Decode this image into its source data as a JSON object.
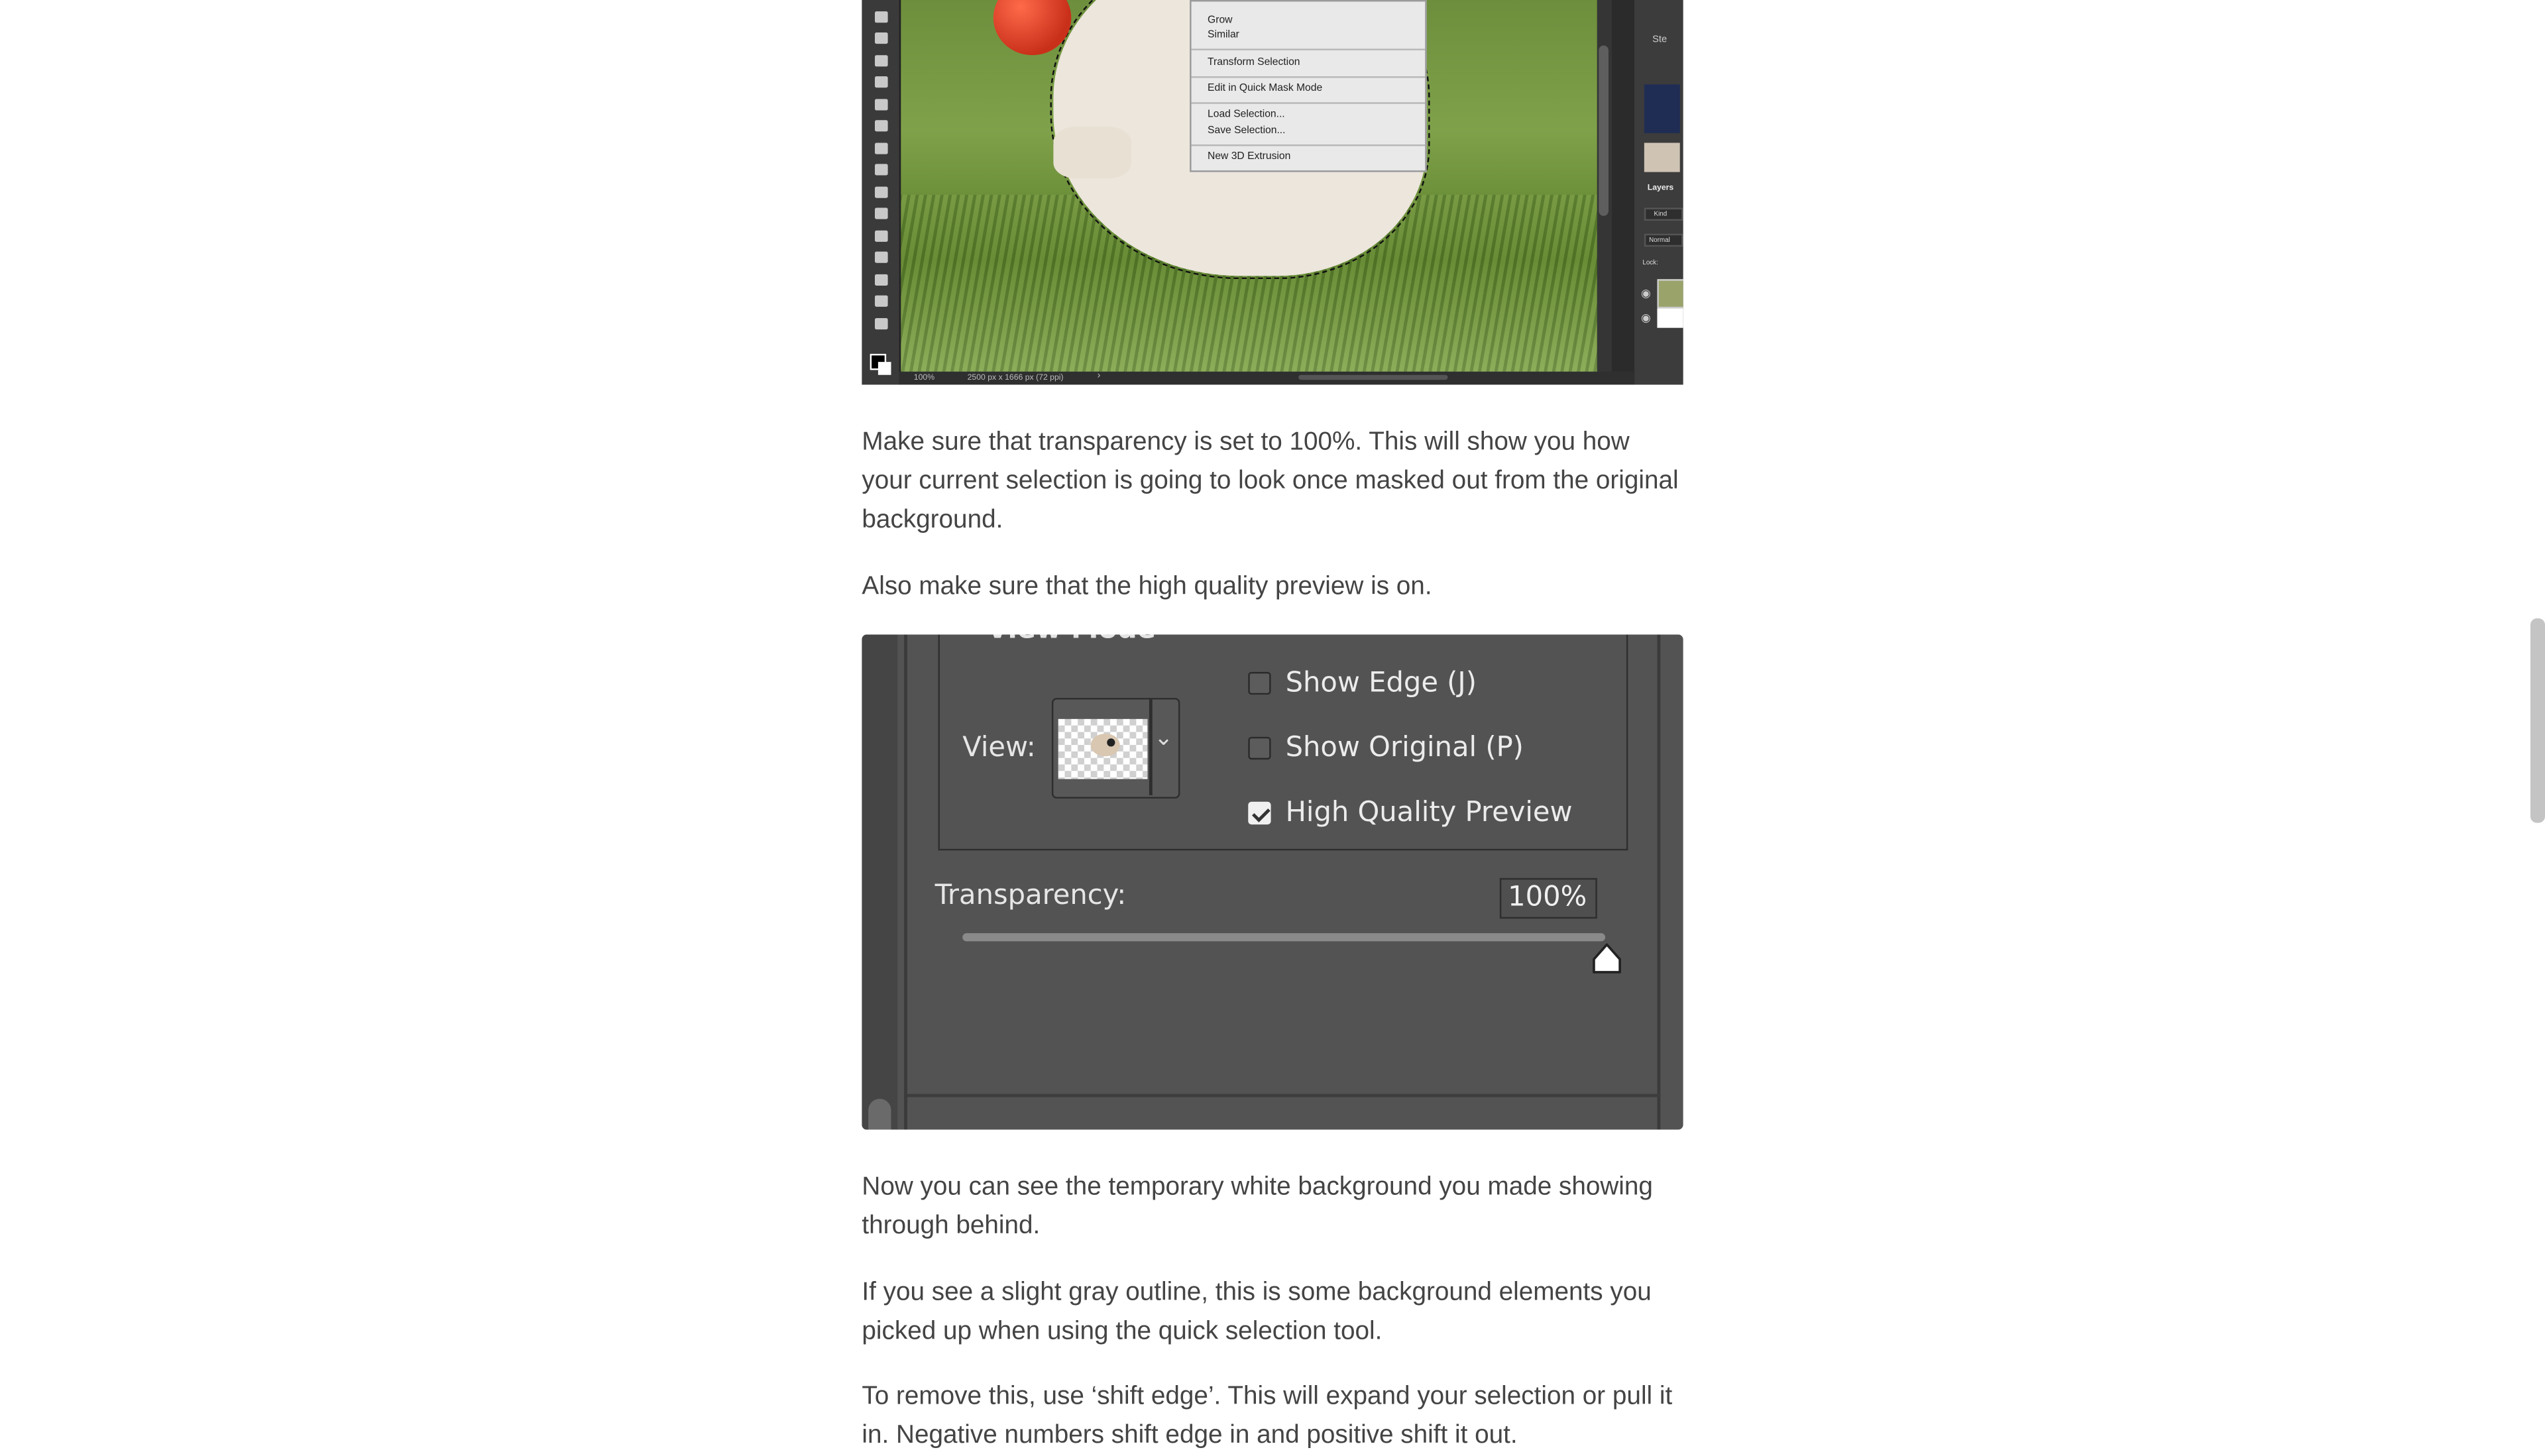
{
  "menu": {
    "items": [
      "Grow",
      "Similar",
      "Transform Selection",
      "Edit in Quick Mask Mode",
      "Load Selection...",
      "Save Selection...",
      "New 3D Extrusion"
    ]
  },
  "status_bar": {
    "zoom": "100%",
    "doc_info": "2500 px x 1666 px (72 ppi)"
  },
  "panel_labels": [
    "Ste",
    "Layers",
    "Kind",
    "Normal",
    "Lock:"
  ],
  "paragraphs": {
    "p1": "Make sure that transparency is set to 100%. This will show you how your current selection is going to look once masked out from the original background.",
    "p2": "Also make sure that the high quality preview is on.",
    "p3": "Now you can see the temporary white background you made showing through behind.",
    "p4": "If you see a slight gray outline, this is some background elements you picked up when using the quick selection tool.",
    "p5": "To remove this, use ‘shift edge’. This will expand your selection or pull it in. Negative numbers shift edge in and positive shift it out."
  },
  "view_mode_panel": {
    "section_title": "View Mode",
    "view_label": "View:",
    "checkboxes": [
      {
        "label": "Show Edge (J)",
        "checked": false
      },
      {
        "label": "Show Original (P)",
        "checked": false
      },
      {
        "label": "High Quality Preview",
        "checked": true
      }
    ],
    "transparency_label": "Transparency:",
    "transparency_value": "100%",
    "transparency_level": 1.0
  },
  "colors": {
    "body_text": "#444444",
    "panel_bg": "#535353",
    "scrollbar": "#c4c4c4"
  }
}
